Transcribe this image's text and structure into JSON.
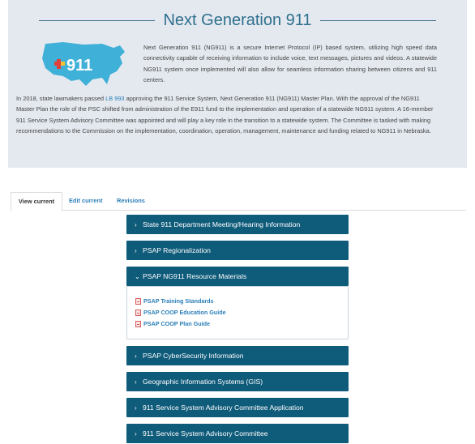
{
  "page": {
    "title": "Next Generation 911",
    "intro": "Next Generation 911 (NG911) is a secure Internet Protocol (IP) based system, utilizing high speed data connectivity capable of receiving information to include voice, text messages, pictures and videos. A statewide NG911 system once implemented will also allow for seamless information sharing between citizens and 911 centers.",
    "paragraph_before_link": "In 2018, state lawmakers passed ",
    "link_text": "LB 993",
    "paragraph_after_link": " approving the 911 Service System, Next Generation 911 (NG911) Master Plan. With the approval of the NG911 Master Plan the role of the PSC shifted from administration of the E911 fund to the implementation and operation of a statewide NG911 system. A 16-member 911 Service System Advisory Committee was appointed and will play a key role in the transition to a statewide system. The Committee is tasked with making recommendations to the Commission on the implementation, coordination, operation, management, maintenance and funding related to NG911 in Nebraska.",
    "logo_text": "911"
  },
  "tabs": [
    "View current",
    "Edit current",
    "Revisions"
  ],
  "accordion": [
    {
      "label": "State 911 Department Meeting/Hearing Information",
      "icon": "›"
    },
    {
      "label": "PSAP Regionalization",
      "icon": "›"
    },
    {
      "label": "PSAP NG911 Resource Materials",
      "icon": "⌄"
    },
    {
      "label": "PSAP CyberSecurity Information",
      "icon": "›"
    },
    {
      "label": "Geographic Information Systems (GIS)",
      "icon": "›"
    },
    {
      "label": "911 Service System Advisory Committee Application",
      "icon": "›"
    },
    {
      "label": "911 Service System Advisory Committee",
      "icon": "›"
    }
  ],
  "resources": [
    "PSAP Training Standards",
    "PSAP COOP Education Guide",
    "PSAP COOP Plan Guide"
  ],
  "colors": {
    "accent": "#0f5b7a",
    "link": "#2b7fb8",
    "hero_bg": "#e4e9ef"
  }
}
